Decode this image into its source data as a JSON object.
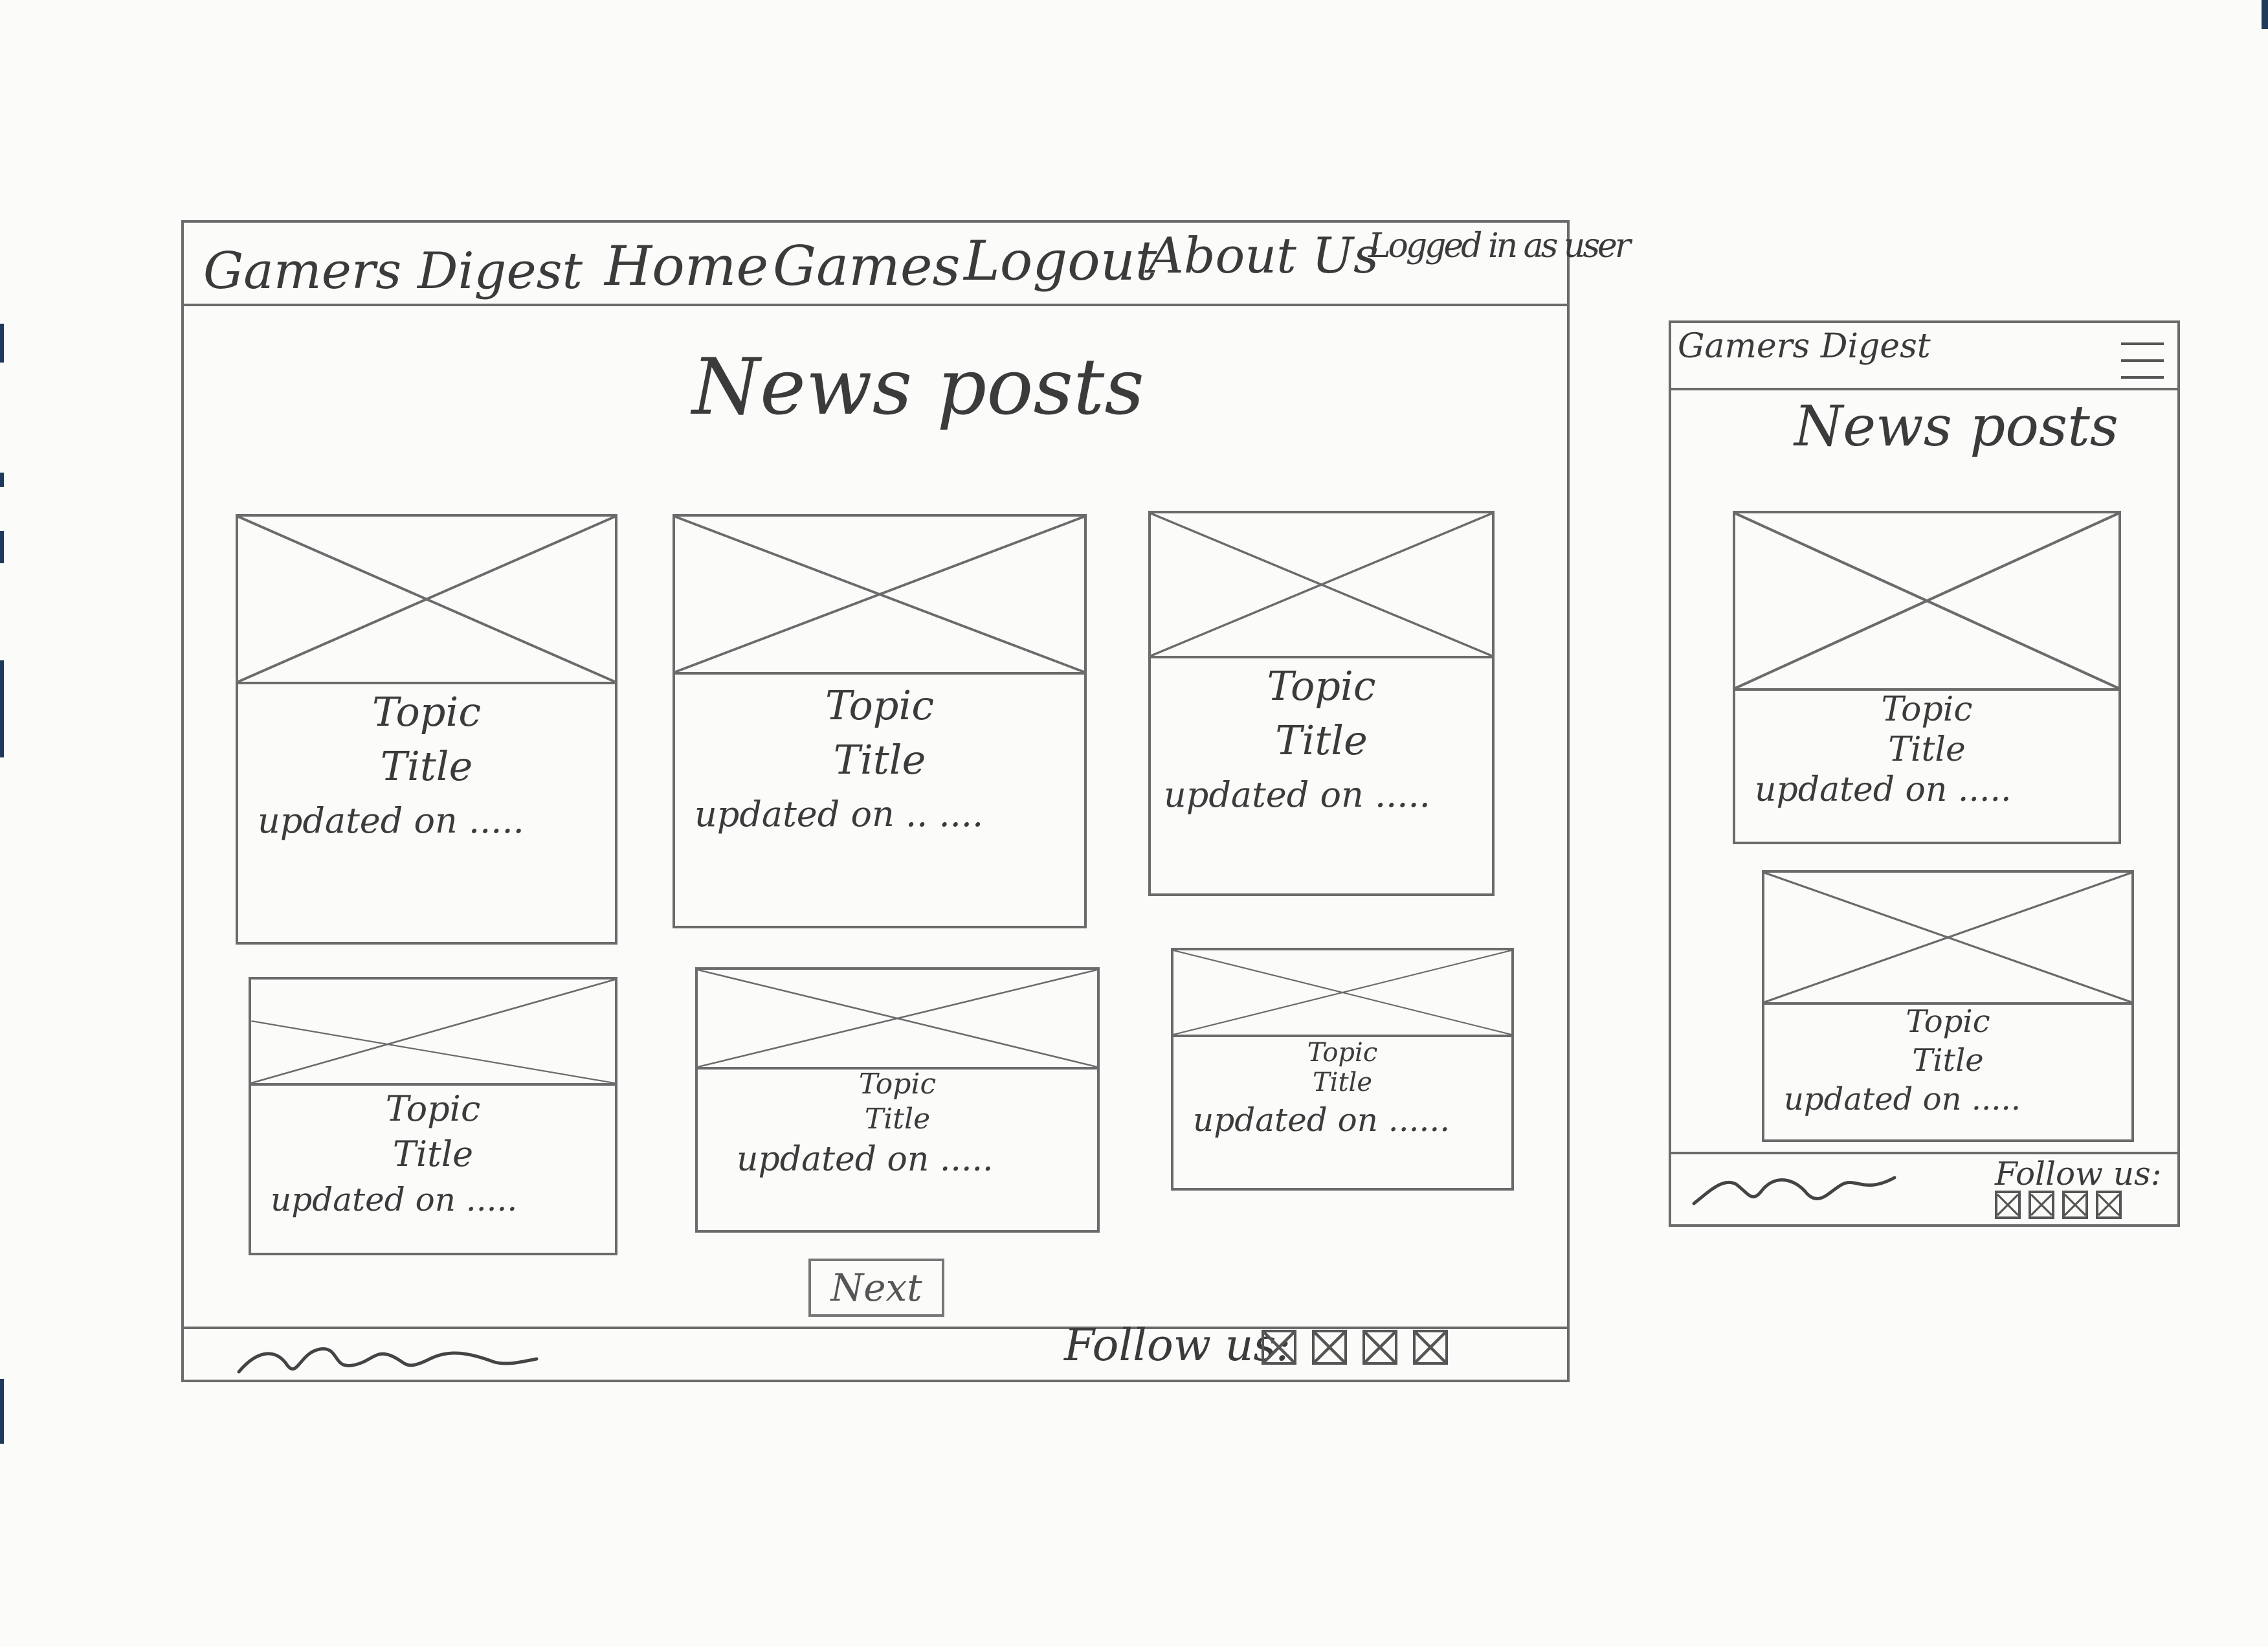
{
  "desktop": {
    "brand": "Gamers Digest",
    "nav": [
      "Home",
      "Games",
      "Logout",
      "About Us"
    ],
    "login_status": "Logged in as user",
    "heading": "News posts",
    "cards": [
      {
        "topic": "Topic",
        "title": "Title",
        "updated": "updated on ....."
      },
      {
        "topic": "Topic",
        "title": "Title",
        "updated": "updated on .. ...."
      },
      {
        "topic": "Topic",
        "title": "Title",
        "updated": "updated on ....."
      },
      {
        "topic": "Topic",
        "title": "Title",
        "updated": "updated on ....."
      },
      {
        "topic": "Topic",
        "title": "Title",
        "updated": "updated on ....."
      },
      {
        "topic": "Topic",
        "title": "Title",
        "updated": "updated on ......"
      }
    ],
    "next_label": "Next",
    "follow_label": "Follow us:",
    "social_icons": [
      "social-icon",
      "social-icon",
      "social-icon",
      "social-icon"
    ]
  },
  "mobile": {
    "brand": "Gamers Digest",
    "heading": "News posts",
    "menu_icon": "hamburger-menu-icon",
    "cards": [
      {
        "topic": "Topic",
        "title": "Title",
        "updated": "updated on ....."
      },
      {
        "topic": "Topic",
        "title": "Title",
        "updated": "updated on ....."
      }
    ],
    "follow_label": "Follow us:",
    "social_icons": [
      "social-icon",
      "social-icon",
      "social-icon",
      "social-icon"
    ]
  }
}
